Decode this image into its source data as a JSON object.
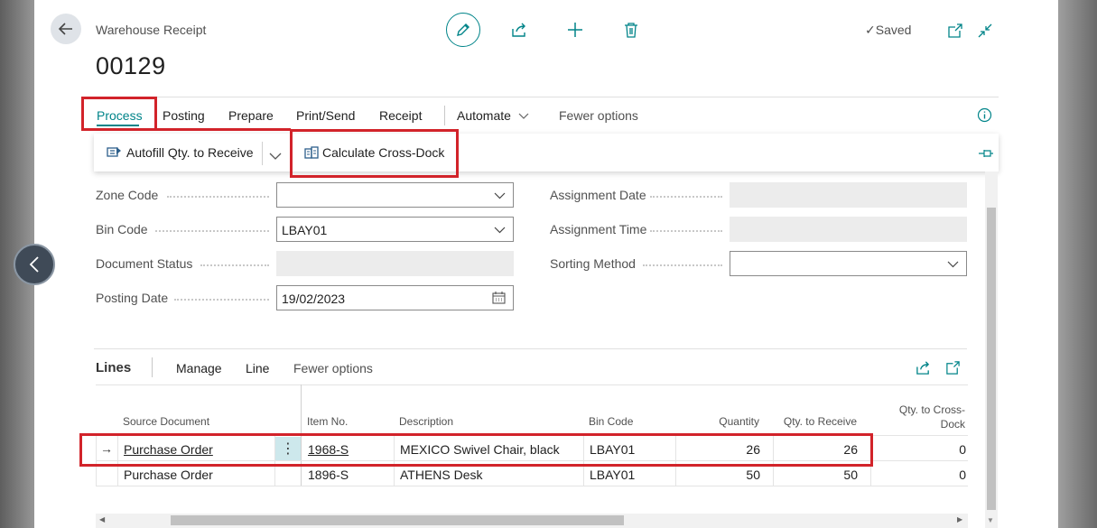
{
  "header": {
    "breadcrumb": "Warehouse Receipt",
    "document_no": "00129",
    "saved_label": "Saved"
  },
  "menu": {
    "items": [
      "Process",
      "Posting",
      "Prepare",
      "Print/Send",
      "Receipt"
    ],
    "automate": "Automate",
    "fewer_options": "Fewer options"
  },
  "actions": {
    "autofill": "Autofill Qty. to Receive",
    "calculate": "Calculate Cross-Dock"
  },
  "fields": {
    "zone_code": {
      "label": "Zone Code",
      "value": ""
    },
    "bin_code": {
      "label": "Bin Code",
      "value": "LBAY01"
    },
    "document_status": {
      "label": "Document Status",
      "value": ""
    },
    "posting_date": {
      "label": "Posting Date",
      "value": "19/02/2023"
    },
    "assignment_date": {
      "label": "Assignment Date",
      "value": ""
    },
    "assignment_time": {
      "label": "Assignment Time",
      "value": ""
    },
    "sorting_method": {
      "label": "Sorting Method",
      "value": ""
    }
  },
  "lines": {
    "title": "Lines",
    "menu": [
      "Manage",
      "Line",
      "Fewer options"
    ],
    "columns": {
      "source_document": "Source Document",
      "item_no": "Item No.",
      "description": "Description",
      "bin_code": "Bin Code",
      "quantity": "Quantity",
      "qty_to_receive": "Qty. to Receive",
      "qty_cross_dock_1": "Qty. to Cross-",
      "qty_cross_dock_2": "Dock"
    },
    "rows": [
      {
        "source_document": "Purchase Order",
        "item_no": "1968-S",
        "description": "MEXICO Swivel Chair, black",
        "bin_code": "LBAY01",
        "quantity": "26",
        "qty_to_receive": "26",
        "qty_cross_dock": "0"
      },
      {
        "source_document": "Purchase Order",
        "item_no": "1896-S",
        "description": "ATHENS Desk",
        "bin_code": "LBAY01",
        "quantity": "50",
        "qty_to_receive": "50",
        "qty_cross_dock": "0"
      }
    ]
  },
  "colors": {
    "accent": "#008489",
    "highlight_red": "#d2232a"
  }
}
